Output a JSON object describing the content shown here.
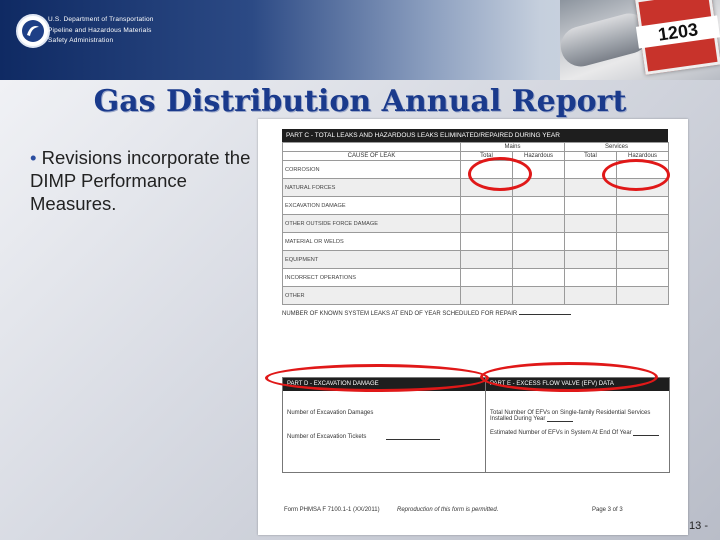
{
  "header": {
    "agency_line1": "U.S. Department of Transportation",
    "agency_line2": "Pipeline and Hazardous Materials",
    "agency_line3": "Safety Administration",
    "placard_number": "1203"
  },
  "title": "Gas Distribution Annual Report",
  "bullet": {
    "marker": "•",
    "text": "Revisions incorporate the DIMP Performance Measures."
  },
  "form": {
    "part_c_title": "PART C - TOTAL LEAKS AND HAZARDOUS LEAKS ELIMINATED/REPAIRED DURING YEAR",
    "group_mains": "Mains",
    "group_services": "Services",
    "col_cause": "CAUSE OF LEAK",
    "col_total": "Total",
    "col_hazardous": "Hazardous",
    "causes": [
      "CORROSION",
      "NATURAL FORCES",
      "EXCAVATION DAMAGE",
      "OTHER OUTSIDE FORCE DAMAGE",
      "MATERIAL OR WELDS",
      "EQUIPMENT",
      "INCORRECT OPERATIONS",
      "OTHER"
    ],
    "known_leaks": "NUMBER OF KNOWN SYSTEM LEAKS AT END OF YEAR SCHEDULED FOR REPAIR",
    "part_d_title": "PART D - EXCAVATION DAMAGE",
    "part_d_row1": "Number of Excavation Damages",
    "part_d_row2": "Number of Excavation Tickets",
    "part_e_title": "PART E - EXCESS FLOW VALVE (EFV) DATA",
    "part_e_row1": "Total Number Of EFVs on Single-family Residential Services Installed During Year",
    "part_e_row2": "Estimated Number of EFVs in System At End Of Year",
    "footer_form": "Form PHMSA F 7100.1-1 (XX/2011)",
    "footer_repro": "Reproduction of this form is permitted.",
    "footer_page": "Page 3 of 3"
  },
  "page_number": "13 -",
  "colors": {
    "title": "#1a3a8c",
    "highlight": "#e01818",
    "header_dark": "#0f2a63"
  }
}
